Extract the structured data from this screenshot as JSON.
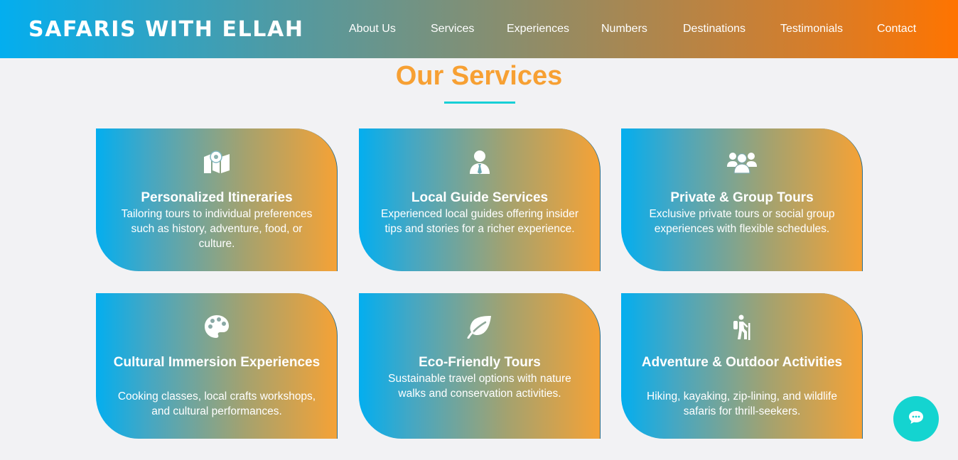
{
  "brand": "SAFARIS WITH ELLAH",
  "nav": [
    "About Us",
    "Services",
    "Experiences",
    "Numbers",
    "Destinations",
    "Testimonials",
    "Contact"
  ],
  "section": {
    "title": "Our Services"
  },
  "services": [
    {
      "icon": "map-icon",
      "title": "Personalized Itineraries",
      "description": "Tailoring tours to individual preferences such as history, adventure, food, or culture."
    },
    {
      "icon": "user-tie-icon",
      "title": "Local Guide Services",
      "description": "Experienced local guides offering insider tips and stories for a richer experience."
    },
    {
      "icon": "users-icon",
      "title": "Private & Group Tours",
      "description": "Exclusive private tours or social group experiences with flexible schedules."
    },
    {
      "icon": "palette-icon",
      "title": "Cultural Immersion Experiences",
      "description": "Cooking classes, local crafts workshops, and cultural performances."
    },
    {
      "icon": "leaf-icon",
      "title": "Eco-Friendly Tours",
      "description": "Sustainable travel options with nature walks and conservation activities."
    },
    {
      "icon": "hiking-icon",
      "title": "Adventure & Outdoor Activities",
      "description": "Hiking, kayaking, zip-lining, and wildlife safaris for thrill-seekers."
    }
  ],
  "chat": {
    "icon": "chat-icon"
  },
  "colors": {
    "accent": "#f7a033",
    "underline": "#17cfd6",
    "chat": "#14d4d0",
    "gradient_start": "#03aeef",
    "gradient_end": "#ff7400"
  }
}
